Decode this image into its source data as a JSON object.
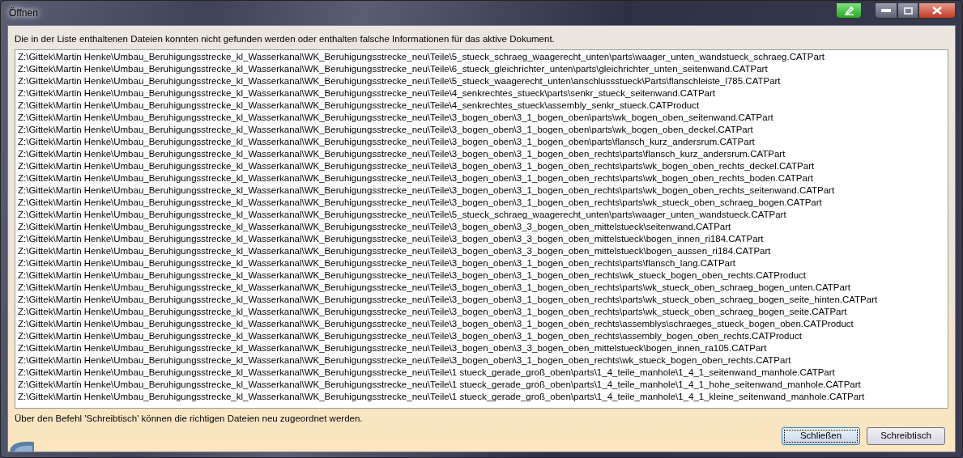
{
  "window": {
    "title": "Öffnen"
  },
  "message": "Die in der Liste enthaltenen Dateien konnten nicht gefunden werden oder enthalten falsche Informationen für das aktive Dokument.",
  "files": [
    "Z:\\Gittek\\Martin Henke\\Umbau_Beruhigungsstrecke_kl_Wasserkanal\\WK_Beruhigungsstrecke_neu\\Teile\\5_stueck_schraeg_waagerecht_unten\\parts\\waager_unten_wandstueck_schraeg.CATPart",
    "Z:\\Gittek\\Martin Henke\\Umbau_Beruhigungsstrecke_kl_Wasserkanal\\WK_Beruhigungsstrecke_neu\\Teile\\6_stueck_gleichrichter_unten\\parts\\gleichrichter_unten_seitenwand.CATPart",
    "Z:\\Gittek\\Martin Henke\\Umbau_Beruhigungsstrecke_kl_Wasserkanal\\WK_Beruhigungsstrecke_neu\\Teile\\5_stueck_waagerecht_unten\\anschlussstueck\\Parts\\flanschleiste_l785.CATPart",
    "Z:\\Gittek\\Martin Henke\\Umbau_Beruhigungsstrecke_kl_Wasserkanal\\WK_Beruhigungsstrecke_neu\\Teile\\4_senkrechtes_stueck\\parts\\senkr_stueck_seitenwand.CATPart",
    "Z:\\Gittek\\Martin Henke\\Umbau_Beruhigungsstrecke_kl_Wasserkanal\\WK_Beruhigungsstrecke_neu\\Teile\\4_senkrechtes_stueck\\assembly_senkr_stueck.CATProduct",
    "Z:\\Gittek\\Martin Henke\\Umbau_Beruhigungsstrecke_kl_Wasserkanal\\WK_Beruhigungsstrecke_neu\\Teile\\3_bogen_oben\\3_1_bogen_oben\\parts\\wk_bogen_oben_seitenwand.CATPart",
    "Z:\\Gittek\\Martin Henke\\Umbau_Beruhigungsstrecke_kl_Wasserkanal\\WK_Beruhigungsstrecke_neu\\Teile\\3_bogen_oben\\3_1_bogen_oben\\parts\\wk_bogen_oben_deckel.CATPart",
    "Z:\\Gittek\\Martin Henke\\Umbau_Beruhigungsstrecke_kl_Wasserkanal\\WK_Beruhigungsstrecke_neu\\Teile\\3_bogen_oben\\3_1_bogen_oben\\parts\\flansch_kurz_andersrum.CATPart",
    "Z:\\Gittek\\Martin Henke\\Umbau_Beruhigungsstrecke_kl_Wasserkanal\\WK_Beruhigungsstrecke_neu\\Teile\\3_bogen_oben\\3_1_bogen_oben_rechts\\parts\\flansch_kurz_andersrum.CATPart",
    "Z:\\Gittek\\Martin Henke\\Umbau_Beruhigungsstrecke_kl_Wasserkanal\\WK_Beruhigungsstrecke_neu\\Teile\\3_bogen_oben\\3_1_bogen_oben_rechts\\parts\\wk_bogen_oben_rechts_deckel.CATPart",
    "Z:\\Gittek\\Martin Henke\\Umbau_Beruhigungsstrecke_kl_Wasserkanal\\WK_Beruhigungsstrecke_neu\\Teile\\3_bogen_oben\\3_1_bogen_oben_rechts\\parts\\wk_bogen_oben_rechts_boden.CATPart",
    "Z:\\Gittek\\Martin Henke\\Umbau_Beruhigungsstrecke_kl_Wasserkanal\\WK_Beruhigungsstrecke_neu\\Teile\\3_bogen_oben\\3_1_bogen_oben_rechts\\parts\\wk_bogen_oben_rechts_seitenwand.CATPart",
    "Z:\\Gittek\\Martin Henke\\Umbau_Beruhigungsstrecke_kl_Wasserkanal\\WK_Beruhigungsstrecke_neu\\Teile\\3_bogen_oben\\3_1_bogen_oben_rechts\\parts\\wk_stueck_oben_schraeg_bogen.CATPart",
    "Z:\\Gittek\\Martin Henke\\Umbau_Beruhigungsstrecke_kl_Wasserkanal\\WK_Beruhigungsstrecke_neu\\Teile\\5_stueck_schraeg_waagerecht_unten\\parts\\waager_unten_wandstueck.CATPart",
    "Z:\\Gittek\\Martin Henke\\Umbau_Beruhigungsstrecke_kl_Wasserkanal\\WK_Beruhigungsstrecke_neu\\Teile\\3_bogen_oben\\3_3_bogen_oben_mittelstueck\\seitenwand.CATPart",
    "Z:\\Gittek\\Martin Henke\\Umbau_Beruhigungsstrecke_kl_Wasserkanal\\WK_Beruhigungsstrecke_neu\\Teile\\3_bogen_oben\\3_3_bogen_oben_mittelstueck\\bogen_innen_ri184.CATPart",
    "Z:\\Gittek\\Martin Henke\\Umbau_Beruhigungsstrecke_kl_Wasserkanal\\WK_Beruhigungsstrecke_neu\\Teile\\3_bogen_oben\\3_3_bogen_oben_mittelstueck\\bogen_aussen_ri184.CATPart",
    "Z:\\Gittek\\Martin Henke\\Umbau_Beruhigungsstrecke_kl_Wasserkanal\\WK_Beruhigungsstrecke_neu\\Teile\\3_bogen_oben\\3_1_bogen_oben_rechts\\parts\\flansch_lang.CATPart",
    "Z:\\Gittek\\Martin Henke\\Umbau_Beruhigungsstrecke_kl_Wasserkanal\\WK_Beruhigungsstrecke_neu\\Teile\\3_bogen_oben\\3_1_bogen_oben_rechts\\wk_stueck_bogen_oben_rechts.CATProduct",
    "Z:\\Gittek\\Martin Henke\\Umbau_Beruhigungsstrecke_kl_Wasserkanal\\WK_Beruhigungsstrecke_neu\\Teile\\3_bogen_oben\\3_1_bogen_oben_rechts\\parts\\wk_stueck_oben_schraeg_bogen_unten.CATPart",
    "Z:\\Gittek\\Martin Henke\\Umbau_Beruhigungsstrecke_kl_Wasserkanal\\WK_Beruhigungsstrecke_neu\\Teile\\3_bogen_oben\\3_1_bogen_oben_rechts\\parts\\wk_stueck_oben_schraeg_bogen_seite_hinten.CATPart",
    "Z:\\Gittek\\Martin Henke\\Umbau_Beruhigungsstrecke_kl_Wasserkanal\\WK_Beruhigungsstrecke_neu\\Teile\\3_bogen_oben\\3_1_bogen_oben_rechts\\parts\\wk_stueck_oben_schraeg_bogen_seite.CATPart",
    "Z:\\Gittek\\Martin Henke\\Umbau_Beruhigungsstrecke_kl_Wasserkanal\\WK_Beruhigungsstrecke_neu\\Teile\\3_bogen_oben\\3_1_bogen_oben_rechts\\assemblys\\schraeges_stueck_bogen_oben.CATProduct",
    "Z:\\Gittek\\Martin Henke\\Umbau_Beruhigungsstrecke_kl_Wasserkanal\\WK_Beruhigungsstrecke_neu\\Teile\\3_bogen_oben\\3_1_bogen_oben_rechts\\assembly_bogen_oben_rechts.CATProduct",
    "Z:\\Gittek\\Martin Henke\\Umbau_Beruhigungsstrecke_kl_Wasserkanal\\WK_Beruhigungsstrecke_neu\\Teile\\3_bogen_oben\\3_3_bogen_oben_mittelstueck\\bogen_innen_ra105.CATPart",
    "Z:\\Gittek\\Martin Henke\\Umbau_Beruhigungsstrecke_kl_Wasserkanal\\WK_Beruhigungsstrecke_neu\\Teile\\3_bogen_oben\\3_1_bogen_oben_rechts\\wk_stueck_bogen_oben_rechts.CATPart",
    "Z:\\Gittek\\Martin Henke\\Umbau_Beruhigungsstrecke_kl_Wasserkanal\\WK_Beruhigungsstrecke_neu\\Teile\\1 stueck_gerade_groß_oben\\parts\\1_4_teile_manhole\\1_4_1_seitenwand_manhole.CATPart",
    "Z:\\Gittek\\Martin Henke\\Umbau_Beruhigungsstrecke_kl_Wasserkanal\\WK_Beruhigungsstrecke_neu\\Teile\\1 stueck_gerade_groß_oben\\parts\\1_4_teile_manhole\\1_4_1_hohe_seitenwand_manhole.CATPart",
    "Z:\\Gittek\\Martin Henke\\Umbau_Beruhigungsstrecke_kl_Wasserkanal\\WK_Beruhigungsstrecke_neu\\Teile\\1 stueck_gerade_groß_oben\\parts\\1_4_teile_manhole\\1_4_1_kleine_seitenwand_manhole.CATPart"
  ],
  "hint": "Über den Befehl 'Schreibtisch' können die richtigen Dateien neu zugeordnet werden.",
  "buttons": [
    {
      "label": "Schließen",
      "focused": true
    },
    {
      "label": "Schreibtisch",
      "focused": false
    }
  ]
}
